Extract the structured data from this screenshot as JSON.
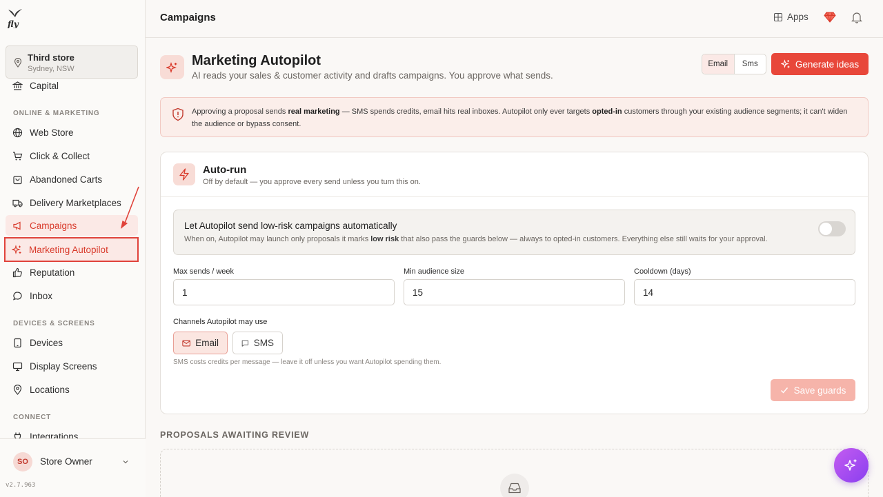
{
  "brand": {
    "logo_text": "fly"
  },
  "store": {
    "name": "Third store",
    "location": "Sydney, NSW"
  },
  "sidebar": {
    "partial_item": "Capital",
    "sections": [
      {
        "label": "ONLINE & MARKETING",
        "items": [
          "Web Store",
          "Click & Collect",
          "Abandoned Carts",
          "Delivery Marketplaces",
          "Campaigns",
          "Marketing Autopilot",
          "Reputation",
          "Inbox"
        ]
      },
      {
        "label": "DEVICES & SCREENS",
        "items": [
          "Devices",
          "Display Screens",
          "Locations"
        ]
      },
      {
        "label": "CONNECT",
        "items": [
          "Integrations"
        ]
      }
    ]
  },
  "user": {
    "initials": "SO",
    "name": "Store Owner"
  },
  "version": "v2.7.963",
  "topbar": {
    "title": "Campaigns",
    "apps_label": "Apps"
  },
  "header": {
    "title": "Marketing Autopilot",
    "subtitle": "AI reads your sales & customer activity and drafts campaigns. You approve what sends.",
    "channel_toggle": [
      "Email",
      "Sms"
    ],
    "generate_label": "Generate ideas"
  },
  "notice": {
    "p1": "Approving a proposal sends ",
    "b1": "real marketing",
    "p2": " — SMS spends credits, email hits real inboxes. Autopilot only ever targets ",
    "b2": "opted-in",
    "p3": " customers through your existing audience segments; it can't widen the audience or bypass consent."
  },
  "autorun": {
    "title": "Auto-run",
    "subtitle": "Off by default — you approve every send unless you turn this on.",
    "toggle_title": "Let Autopilot send low-risk campaigns automatically",
    "toggle_sub_p1": "When on, Autopilot may launch only proposals it marks ",
    "toggle_sub_b": "low risk",
    "toggle_sub_p2": " that also pass the guards below — always to opted-in customers. Everything else still waits for your approval.",
    "enabled": false,
    "fields": [
      {
        "label": "Max sends / week",
        "value": "1"
      },
      {
        "label": "Min audience size",
        "value": "15"
      },
      {
        "label": "Cooldown (days)",
        "value": "14"
      }
    ],
    "channels_label": "Channels Autopilot may use",
    "channels": [
      {
        "label": "Email",
        "selected": true
      },
      {
        "label": "SMS",
        "selected": false
      }
    ],
    "hint": "SMS costs credits per message — leave it off unless you want Autopilot spending them.",
    "save_label": "Save guards"
  },
  "proposals": {
    "heading": "PROPOSALS AWAITING REVIEW"
  },
  "colors": {
    "accent": "#e8473a",
    "accent_soft": "#fbe9e6",
    "fab": "#a64ff0"
  }
}
